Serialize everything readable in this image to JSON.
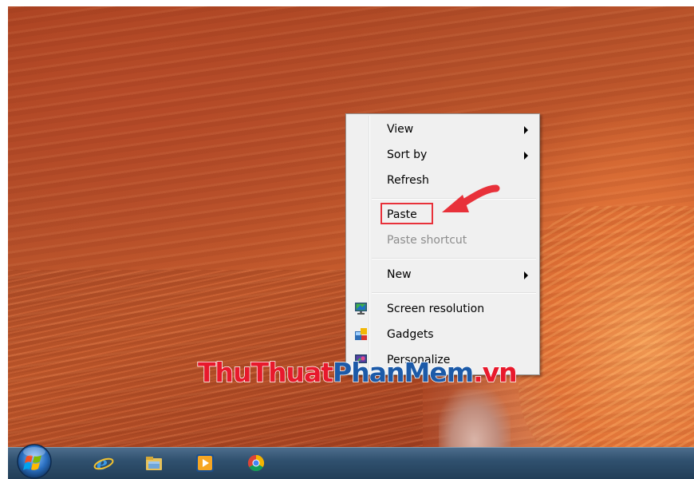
{
  "menu": {
    "items": [
      {
        "label": "View",
        "submenu": true
      },
      {
        "label": "Sort by",
        "submenu": true
      },
      {
        "label": "Refresh"
      },
      {
        "label": "Paste",
        "highlighted": true
      },
      {
        "label": "Paste shortcut",
        "disabled": true
      },
      {
        "label": "New",
        "submenu": true
      },
      {
        "label": "Screen resolution",
        "icon": "monitor-icon"
      },
      {
        "label": "Gadgets",
        "icon": "gadgets-icon"
      },
      {
        "label": "Personalize",
        "icon": "personalize-icon"
      }
    ]
  },
  "watermark": {
    "part1": "ThuThuat",
    "part2": "PhanMem",
    "part3": ".vn"
  },
  "taskbar": {
    "icons": [
      "windows-start-orb-icon",
      "internet-explorer-icon",
      "file-explorer-icon",
      "media-player-icon",
      "chrome-icon"
    ]
  },
  "colors": {
    "annotation": "#e8313a",
    "menu_bg": "#f0f0f0",
    "taskbar": "#30516f"
  }
}
